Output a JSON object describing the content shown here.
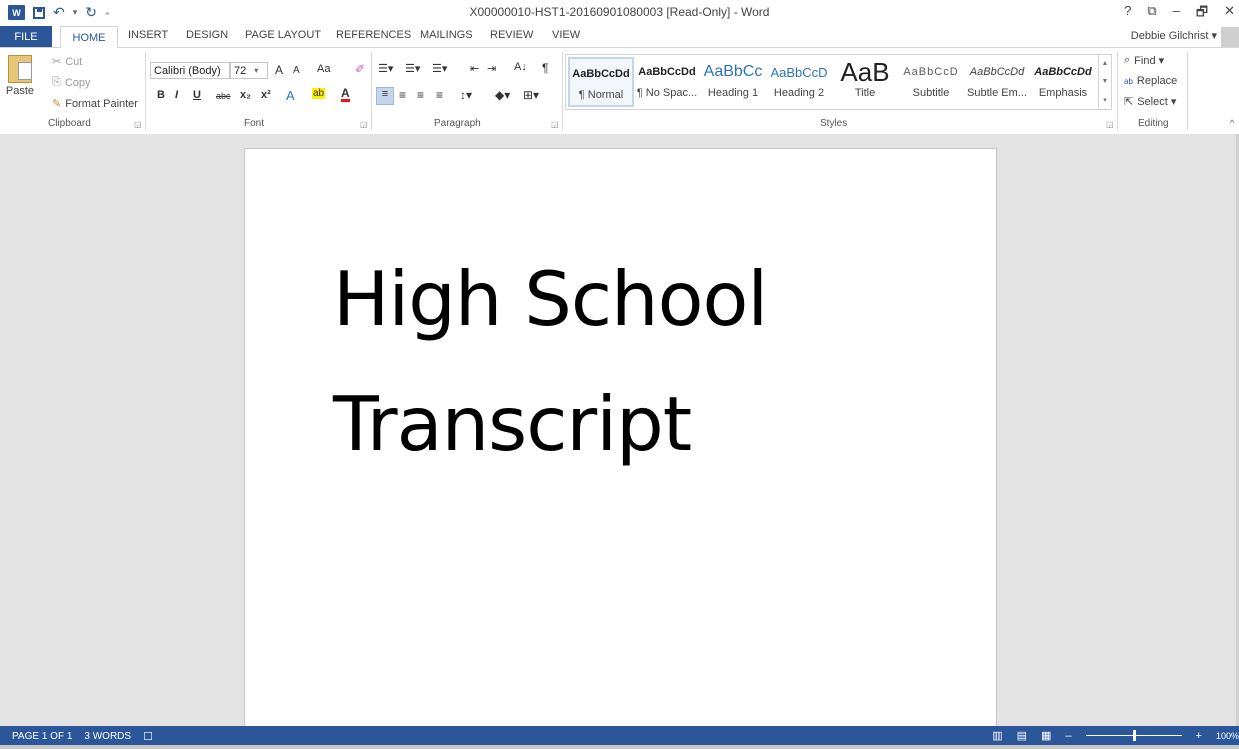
{
  "titlebar": {
    "document_title": "X00000010-HST1-20160901080003 [Read-Only] - Word",
    "help": "?",
    "controls": {
      "ribbon_display": "⧉",
      "minimize": "–",
      "restore": "🗗",
      "close": "✕"
    }
  },
  "quick_access": {
    "logo": "W",
    "undo": "↶",
    "undo_dd": "▾",
    "redo": "↻",
    "customize": "₌"
  },
  "tabs": {
    "file": "FILE",
    "items": [
      "HOME",
      "INSERT",
      "DESIGN",
      "PAGE LAYOUT",
      "REFERENCES",
      "MAILINGS",
      "REVIEW",
      "VIEW"
    ],
    "active": "HOME",
    "user": "Debbie Gilchrist ▾"
  },
  "ribbon": {
    "clipboard": {
      "label": "Clipboard",
      "paste": "Paste",
      "cut": "Cut",
      "copy": "Copy",
      "format_painter": "Format Painter"
    },
    "font": {
      "label": "Font",
      "font_name": "Calibri (Body)",
      "font_size": "72",
      "grow": "A",
      "shrink": "A",
      "change_case": "Aa",
      "bold": "B",
      "italic": "I",
      "underline": "U",
      "strikethrough": "abc",
      "subscript": "x₂",
      "superscript": "x²",
      "text_effects": "A",
      "highlight": "ab",
      "font_color": "A"
    },
    "paragraph": {
      "label": "Paragraph",
      "sort": "A↓",
      "show_marks": "¶"
    },
    "styles": {
      "label": "Styles",
      "items": [
        {
          "sample": "AaBbCcDd",
          "name": "¶ Normal"
        },
        {
          "sample": "AaBbCcDd",
          "name": "¶ No Spac..."
        },
        {
          "sample": "AaBbCc",
          "name": "Heading 1"
        },
        {
          "sample": "AaBbCcD",
          "name": "Heading 2"
        },
        {
          "sample": "AaB",
          "name": "Title"
        },
        {
          "sample": "AaBbCcD",
          "name": "Subtitle"
        },
        {
          "sample": "AaBbCcDd",
          "name": "Subtle Em..."
        },
        {
          "sample": "AaBbCcDd",
          "name": "Emphasis"
        }
      ]
    },
    "editing": {
      "label": "Editing",
      "find": "Find ▾",
      "replace": "Replace",
      "select": "Select ▾"
    }
  },
  "document": {
    "line1": "High School",
    "line2": "Transcript"
  },
  "statusbar": {
    "page": "PAGE 1 OF 1",
    "words": "3 WORDS",
    "zoom": "100%",
    "zoom_out": "–",
    "zoom_in": "+"
  },
  "colors": {
    "accent": "#2b579a",
    "heading_blue": "#2e74b5"
  }
}
